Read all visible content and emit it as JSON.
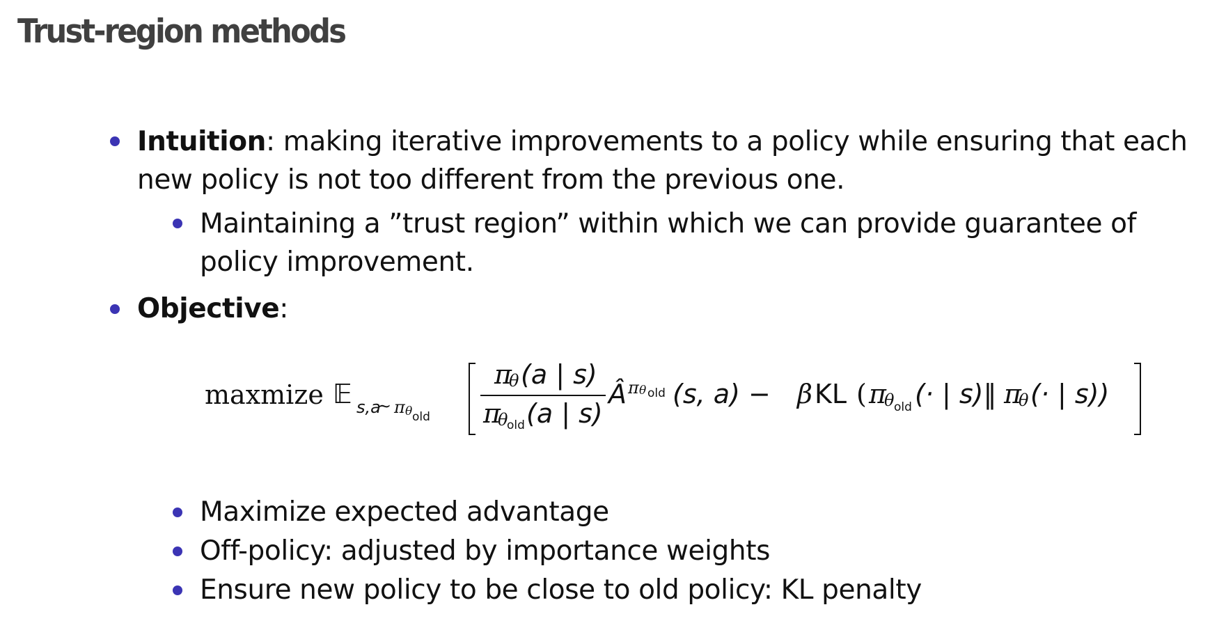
{
  "title": "Trust-region methods",
  "bullets": {
    "intuition": {
      "term": "Intuition",
      "text_line1": ": making iterative improvements to a policy while ensuring that each",
      "text_line2": "new policy is not too different from the previous one."
    },
    "trust_region": {
      "line1": "Maintaining a ”trust region” within which we can provide guarantee of",
      "line2": "policy improvement."
    },
    "objective": {
      "term": "Objective",
      "colon": ":"
    },
    "sub_points": [
      "Maximize expected advantage",
      "Off-policy: adjusted by importance weights",
      "Ensure new policy to be close to old policy: KL penalty"
    ]
  },
  "formula": {
    "operator": "maxmize",
    "expectation": "𝔼",
    "expectation_sub_vars": "s,a",
    "tilde": "∼",
    "pi": "π",
    "theta": "θ",
    "old": "old",
    "numerator_args": "(a | s)",
    "denominator_args": "(a | s)",
    "advantage": "Â",
    "advantage_args": "(s, a) − ",
    "beta": "β",
    "kl": "KL",
    "kl_open": "(",
    "kl_mid_args": "(· | s)‖",
    "kl_end_args": "(· | s))"
  },
  "colors": {
    "bullet": "#3b34b4",
    "title": "#404040",
    "text": "#111111"
  }
}
